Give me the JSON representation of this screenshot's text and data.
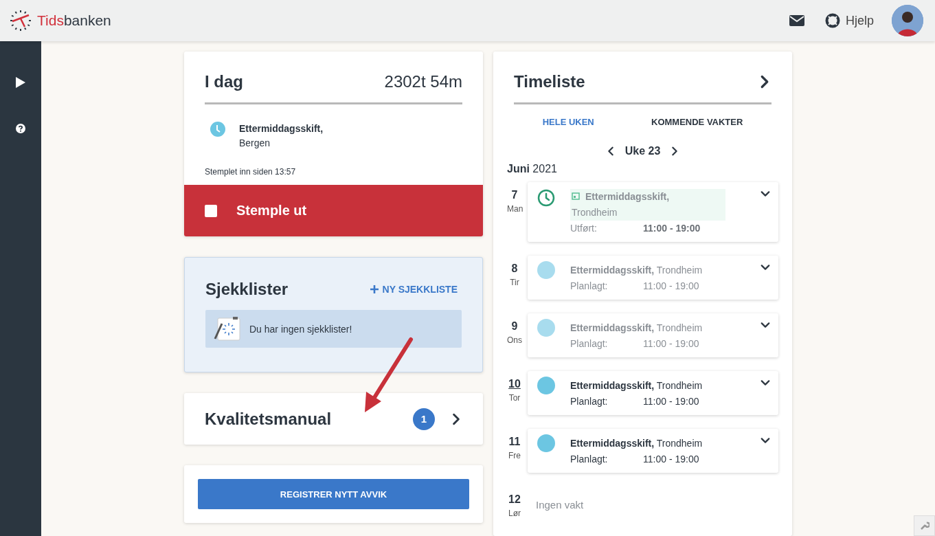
{
  "header": {
    "logo": {
      "first": "Tids",
      "second": "banken"
    },
    "help": "Hjelp"
  },
  "today_card": {
    "title": "I dag",
    "total": "2302t 54m",
    "shift": "Ettermiddagsskift,",
    "location": "Bergen",
    "stamped": "Stemplet inn siden 13:57",
    "button": "Stemple ut"
  },
  "checklists": {
    "title": "Sjekklister",
    "add": "NY SJEKKLISTE",
    "empty": "Du har ingen sjekklister!"
  },
  "quality": {
    "title": "Kvalitetsmanual",
    "count": "1"
  },
  "report_button": "REGISTRER NYTT AVVIK",
  "timesheet": {
    "title": "Timeliste",
    "tabs": [
      {
        "label": "HELE UKEN",
        "selected": true
      },
      {
        "label": "KOMMENDE VAKTER",
        "selected": false
      }
    ],
    "week": "Uke 23",
    "month": "**Juni** 2021",
    "days": [
      {
        "kind": "shift",
        "day": "7",
        "weekday": "Man",
        "today": false,
        "completed": true,
        "past": true,
        "shift": "Ettermiddagsskift,",
        "location": "Trondheim",
        "label": "Utført:",
        "time": "11:00 - 19:00"
      },
      {
        "kind": "shift",
        "day": "8",
        "weekday": "Tir",
        "today": false,
        "completed": false,
        "past": true,
        "shift": "Ettermiddagsskift,",
        "location": "Trondheim",
        "label": "Planlagt:",
        "time": "11:00 - 19:00"
      },
      {
        "kind": "shift",
        "day": "9",
        "weekday": "Ons",
        "today": false,
        "completed": false,
        "past": true,
        "shift": "Ettermiddagsskift,",
        "location": "Trondheim",
        "label": "Planlagt:",
        "time": "11:00 - 19:00"
      },
      {
        "kind": "shift",
        "day": "10",
        "weekday": "Tor",
        "today": true,
        "completed": false,
        "past": false,
        "shift": "Ettermiddagsskift,",
        "location": "Trondheim",
        "label": "Planlagt:",
        "time": "11:00 - 19:00"
      },
      {
        "kind": "shift",
        "day": "11",
        "weekday": "Fre",
        "today": false,
        "completed": false,
        "past": false,
        "shift": "Ettermiddagsskift,",
        "location": "Trondheim",
        "label": "Planlagt:",
        "time": "11:00 - 19:00"
      },
      {
        "kind": "none",
        "day": "12",
        "weekday": "Lør",
        "today": false,
        "text": "Ingen vakt"
      }
    ]
  }
}
